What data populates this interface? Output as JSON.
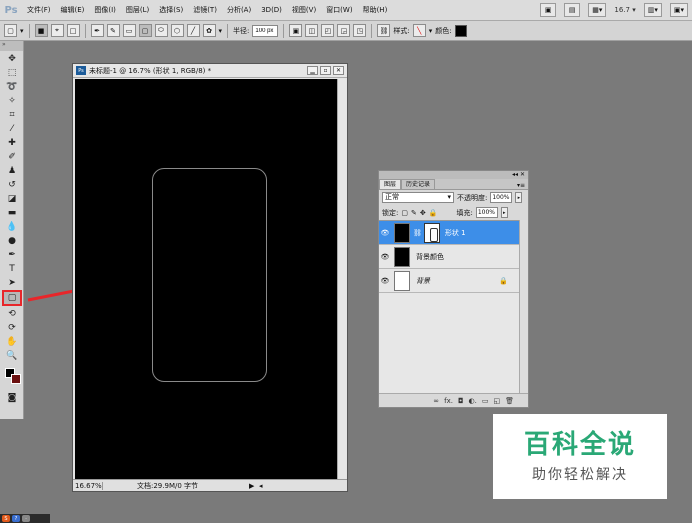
{
  "app": {
    "logo": "Ps",
    "menus": [
      "文件(F)",
      "编辑(E)",
      "图像(I)",
      "图层(L)",
      "选择(S)",
      "滤镜(T)",
      "分析(A)",
      "3D(D)",
      "视图(V)",
      "窗口(W)",
      "帮助(H)"
    ],
    "zoom_value": "16.7"
  },
  "options": {
    "radius_label": "半径:",
    "radius_value": "100 px",
    "style_label": "样式:",
    "color_label": "颜色:",
    "colors": {
      "color_swatch": "#000000"
    }
  },
  "toolbox": {
    "grip": "»",
    "colors": {
      "foreground": "#000000",
      "background": "#6b1010"
    }
  },
  "document": {
    "title": "未标题-1 @ 16.7% (形状 1, RGB/8) *",
    "badge": "Ps",
    "zoom": "16.67%",
    "doc_info": "文档:29.9M/0 字节"
  },
  "layers_panel": {
    "tabs": [
      "图层",
      "历史记录"
    ],
    "blend_mode": "正常",
    "opacity_label": "不透明度:",
    "opacity_value": "100%",
    "lock_label": "锁定:",
    "fill_label": "填充:",
    "fill_value": "100%",
    "layers": [
      {
        "name": "形状 1",
        "selected": true
      },
      {
        "name": "背景颜色",
        "selected": false
      },
      {
        "name": "背景",
        "selected": false
      }
    ],
    "bottom_icons": [
      "∞",
      "fx.",
      "◘",
      "◐.",
      "▭",
      "◱",
      "🗑"
    ]
  },
  "watermark": {
    "title": "百科全说",
    "subtitle": "助你轻松解决"
  },
  "colors": {
    "annotation": "#e8262a",
    "layer_selected": "#3d8ee8",
    "watermark_green": "#2aa876"
  }
}
